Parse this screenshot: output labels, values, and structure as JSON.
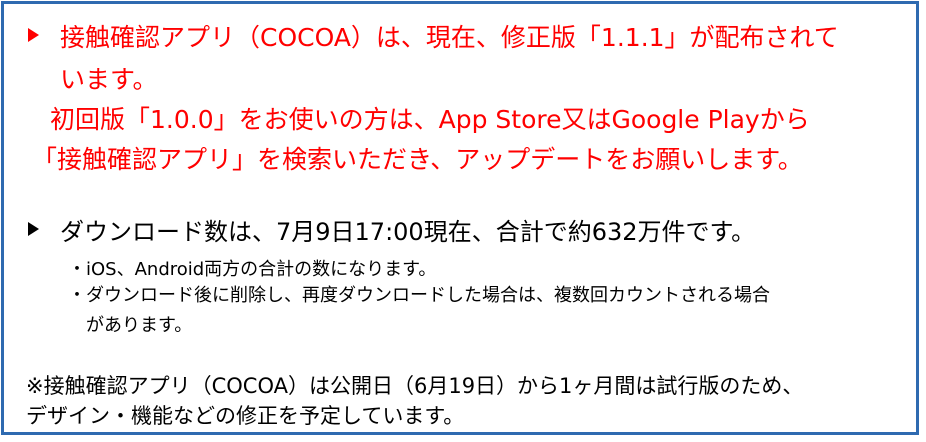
{
  "section1": {
    "line1": "接触確認アプリ（COCOA）は、現在、修正版「1.1.1」が配布されて",
    "line2": "います。",
    "line3": "初回版「1.0.0」をお使いの方は、App Store又はGoogle Playから",
    "line4": "「接触確認アプリ」を検索いただき、アップデートをお願いします。"
  },
  "section2": {
    "heading": "ダウンロード数は、7月9日17:00現在、合計で約632万件です。",
    "sub1": "・iOS、Android両方の合計の数になります。",
    "sub2_line1": "・ダウンロード後に削除し、再度ダウンロードした場合は、複数回カウントされる場合",
    "sub2_line2": "があります。"
  },
  "note": {
    "line1": "※接触確認アプリ（COCOA）は公開日（6月19日）から1ヶ月間は試行版のため、",
    "line2": "デザイン・機能などの修正を予定しています。"
  },
  "colors": {
    "border": "#2e6ab0",
    "highlight_text": "#ff0000",
    "body_text": "#000000"
  }
}
